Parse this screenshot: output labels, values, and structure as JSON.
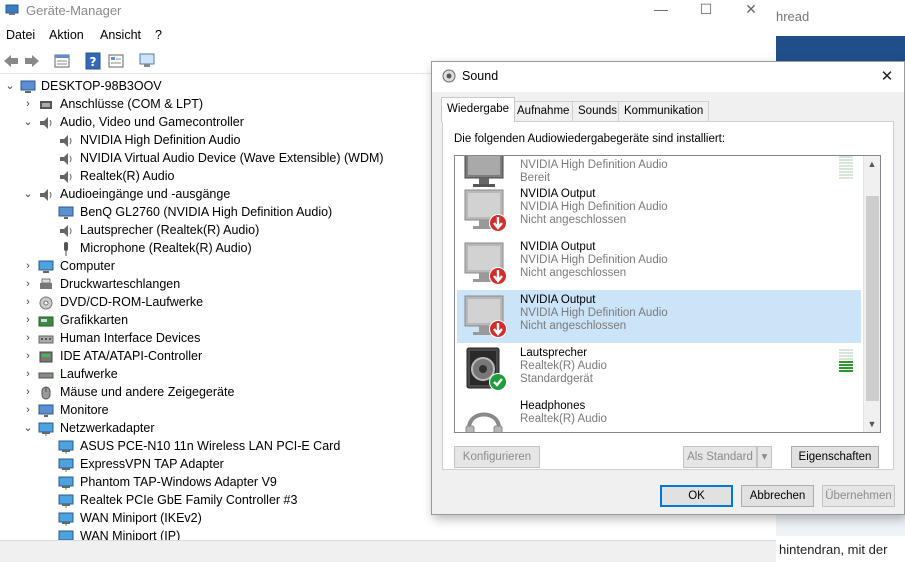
{
  "device_manager": {
    "title": "Geräte-Manager",
    "caption": {
      "minimize": "—",
      "maximize": "☐",
      "close": "✕"
    },
    "menu": [
      "Datei",
      "Aktion",
      "Ansicht",
      "?"
    ],
    "tree": {
      "root": "DESKTOP-98B3OOV",
      "items": [
        {
          "label": "Anschlüsse (COM & LPT)",
          "icon": "port-icon",
          "level": 1,
          "expanded": false
        },
        {
          "label": "Audio, Video und Gamecontroller",
          "icon": "speaker-icon",
          "level": 1,
          "expanded": true
        },
        {
          "label": "NVIDIA High Definition Audio",
          "icon": "speaker-icon",
          "level": 2
        },
        {
          "label": "NVIDIA Virtual Audio Device (Wave Extensible) (WDM)",
          "icon": "speaker-icon",
          "level": 2
        },
        {
          "label": "Realtek(R) Audio",
          "icon": "speaker-icon",
          "level": 2
        },
        {
          "label": "Audioeingänge und -ausgänge",
          "icon": "speaker-icon",
          "level": 1,
          "expanded": true
        },
        {
          "label": "BenQ GL2760 (NVIDIA High Definition Audio)",
          "icon": "monitor-icon",
          "level": 2
        },
        {
          "label": "Lautsprecher (Realtek(R) Audio)",
          "icon": "speaker-icon",
          "level": 2
        },
        {
          "label": "Microphone (Realtek(R) Audio)",
          "icon": "microphone-icon",
          "level": 2
        },
        {
          "label": "Computer",
          "icon": "computer-icon",
          "level": 1,
          "expanded": false
        },
        {
          "label": "Druckwarteschlangen",
          "icon": "printer-icon",
          "level": 1,
          "expanded": false
        },
        {
          "label": "DVD/CD-ROM-Laufwerke",
          "icon": "disc-icon",
          "level": 1,
          "expanded": false
        },
        {
          "label": "Grafikkarten",
          "icon": "display-adapter-icon",
          "level": 1,
          "expanded": false
        },
        {
          "label": "Human Interface Devices",
          "icon": "hid-icon",
          "level": 1,
          "expanded": false
        },
        {
          "label": "IDE ATA/ATAPI-Controller",
          "icon": "controller-icon",
          "level": 1,
          "expanded": false
        },
        {
          "label": "Laufwerke",
          "icon": "drive-icon",
          "level": 1,
          "expanded": false
        },
        {
          "label": "Mäuse und andere Zeigegeräte",
          "icon": "mouse-icon",
          "level": 1,
          "expanded": false
        },
        {
          "label": "Monitore",
          "icon": "monitor-icon",
          "level": 1,
          "expanded": false
        },
        {
          "label": "Netzwerkadapter",
          "icon": "network-icon",
          "level": 1,
          "expanded": true
        },
        {
          "label": "ASUS PCE-N10 11n Wireless LAN PCI-E Card",
          "icon": "network-icon",
          "level": 2
        },
        {
          "label": "ExpressVPN TAP Adapter",
          "icon": "network-icon",
          "level": 2
        },
        {
          "label": "Phantom TAP-Windows Adapter V9",
          "icon": "network-icon",
          "level": 2
        },
        {
          "label": "Realtek PCIe GbE Family Controller #3",
          "icon": "network-icon",
          "level": 2
        },
        {
          "label": "WAN Miniport (IKEv2)",
          "icon": "network-icon",
          "level": 2
        },
        {
          "label": "WAN Miniport (IP)",
          "icon": "network-icon",
          "level": 2
        }
      ]
    }
  },
  "background_browser": {
    "thread_text": "hread",
    "bottom_text": "hintendran, mit der"
  },
  "sound_dialog": {
    "title": "Sound",
    "close": "✕",
    "tabs": [
      "Wiedergabe",
      "Aufnahme",
      "Sounds",
      "Kommunikation"
    ],
    "active_tab": 0,
    "description": "Die folgenden Audiowiedergabegeräte sind installiert:",
    "devices": [
      {
        "name": "",
        "sub": "NVIDIA High Definition Audio",
        "status": "Bereit",
        "icon": "monitor-icon",
        "selected": false
      },
      {
        "name": "NVIDIA Output",
        "sub": "NVIDIA High Definition Audio",
        "status": "Nicht angeschlossen",
        "icon": "monitor-disconnected-icon",
        "selected": false
      },
      {
        "name": "NVIDIA Output",
        "sub": "NVIDIA High Definition Audio",
        "status": "Nicht angeschlossen",
        "icon": "monitor-disconnected-icon",
        "selected": false
      },
      {
        "name": "NVIDIA Output",
        "sub": "NVIDIA High Definition Audio",
        "status": "Nicht angeschlossen",
        "icon": "monitor-disconnected-icon",
        "selected": true
      },
      {
        "name": "Lautsprecher",
        "sub": "Realtek(R) Audio",
        "status": "Standardgerät",
        "icon": "speaker-default-icon",
        "selected": false
      },
      {
        "name": "Headphones",
        "sub": "Realtek(R) Audio",
        "status": "",
        "icon": "headphones-disconnected-icon",
        "selected": false
      }
    ],
    "level_meter": {
      "top_device_lit": 0,
      "lautsprecher_lit": 4,
      "bars": 8
    },
    "buttons": {
      "configure": "Konfigurieren",
      "set_default": "Als Standard",
      "properties": "Eigenschaften",
      "ok": "OK",
      "cancel": "Abbrechen",
      "apply": "Übernehmen"
    },
    "colors": {
      "selection": "#cce4f7",
      "accent": "#0078d7",
      "meter_green": "#2e9a2e"
    }
  }
}
